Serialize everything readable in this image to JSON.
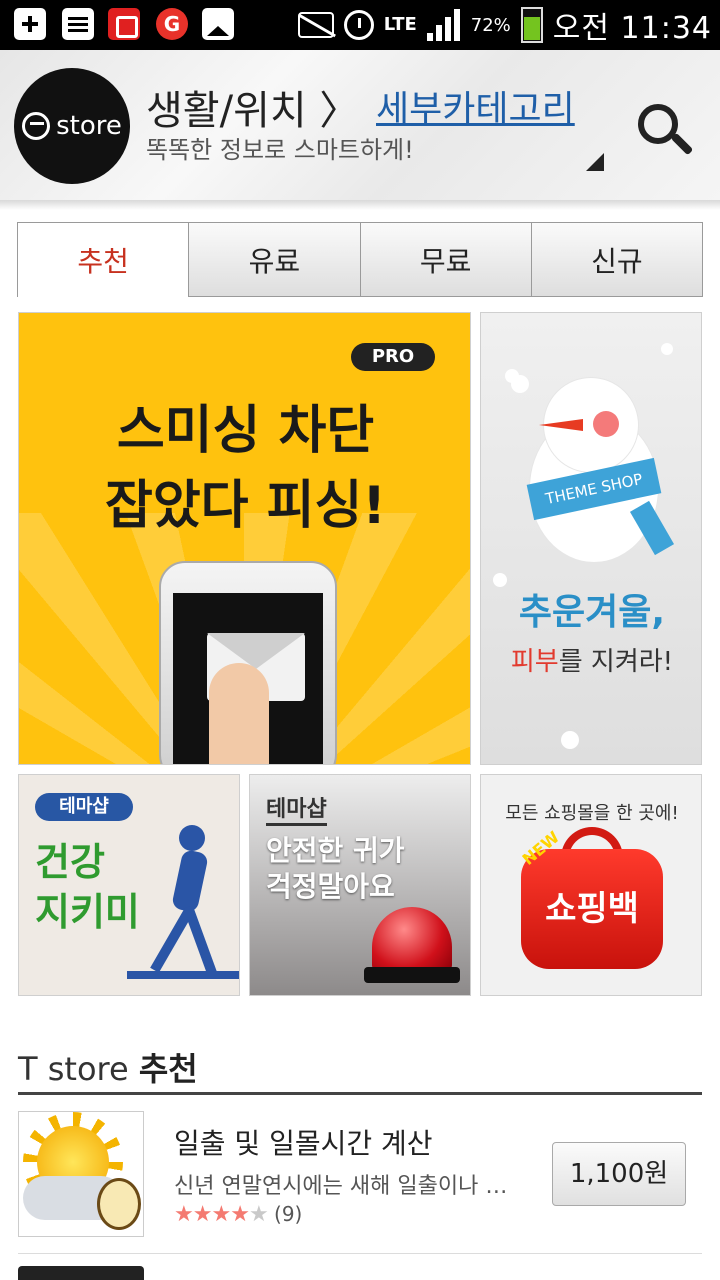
{
  "status_bar": {
    "lte": "LTE",
    "battery": "72%",
    "battery_level": 0.72,
    "time": "오전 11:34",
    "notification_icons": [
      "plus-icon",
      "calendar-icon",
      "gift-icon",
      "g-icon",
      "image-icon"
    ]
  },
  "header": {
    "logo_text": "store",
    "category": "생활/위치",
    "separator": "〉",
    "subcategory": "세부카테고리",
    "tagline": "똑똑한 정보로 스마트하게!"
  },
  "tabs": [
    {
      "label": "추천",
      "active": true
    },
    {
      "label": "유료",
      "active": false
    },
    {
      "label": "무료",
      "active": false
    },
    {
      "label": "신규",
      "active": false
    }
  ],
  "banners": {
    "main": {
      "badge": "PRO",
      "line1": "스미싱 차단",
      "line2": "잡았다 피싱!"
    },
    "theme": {
      "ribbon": "THEME SHOP",
      "line1": "추운겨울,",
      "line2_red": "피부",
      "line2_rest": "를 지켜라!"
    },
    "health": {
      "badge": "테마샵",
      "line1": "건강",
      "line2": "지키미"
    },
    "safety": {
      "badge": "테마샵",
      "line1": "안전한 귀가",
      "line2": "걱정말아요"
    },
    "shopping": {
      "top": "모든 쇼핑몰을 한 곳에!",
      "new": "NEW",
      "bag": "쇼핑백"
    }
  },
  "recommend": {
    "heading_prefix": "T store",
    "heading_suffix": "추천",
    "apps": [
      {
        "title": "일출 및 일몰시간 계산",
        "desc": "신년 연말연시에는 새해 일출이나 …",
        "rating": 4,
        "rating_max": 5,
        "review_count": "(9)",
        "price": "1,100원"
      }
    ]
  },
  "colors": {
    "accent_red": "#c7311f",
    "link_blue": "#1f5fa8",
    "banner_yellow": "#ffc20e",
    "star": "#f47a71"
  }
}
